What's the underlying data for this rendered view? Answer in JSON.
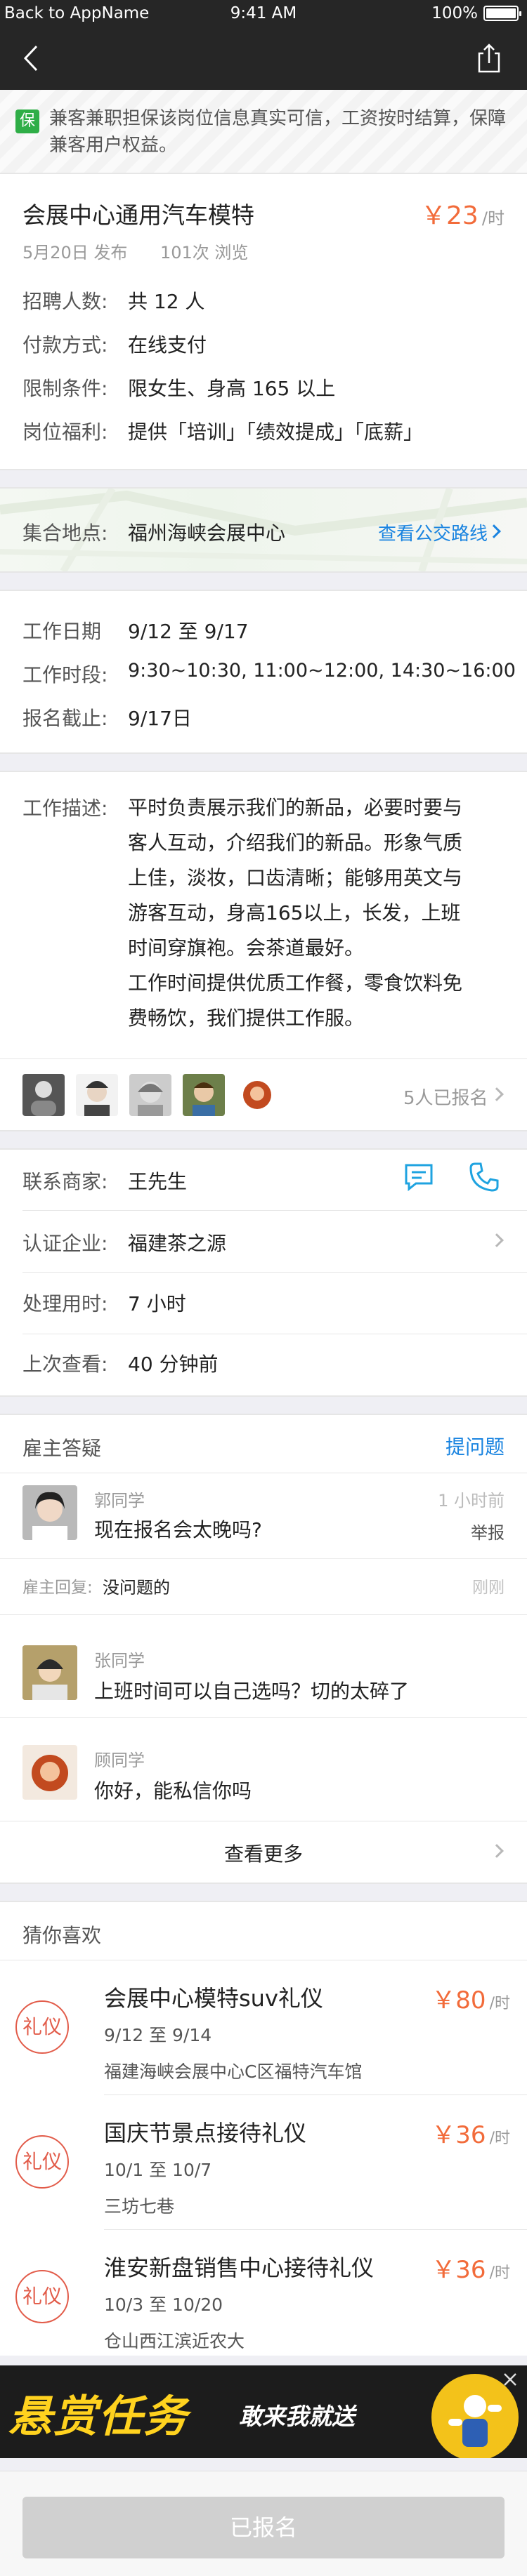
{
  "status": {
    "back": "Back to AppName",
    "time": "9:41 AM",
    "battery": "100%"
  },
  "guarantee": {
    "badge": "保",
    "text": "兼客兼职担保该岗位信息真实可信，工资按时结算，保障兼客用户权益。"
  },
  "job": {
    "title": "会展中心通用汽车模特",
    "salary": "￥23",
    "salary_unit": "/时",
    "date": "5月20日 发布",
    "views": "101次 浏览",
    "rows": [
      {
        "label": "招聘人数:",
        "value": "共 12 人"
      },
      {
        "label": "付款方式:",
        "value": "在线支付"
      },
      {
        "label": "限制条件:",
        "value": "限女生、身高 165 以上"
      },
      {
        "label": "岗位福利:",
        "value": "提供「培训」「绩效提成」「底薪」"
      }
    ]
  },
  "location": {
    "label": "集合地点:",
    "value": "福州海峡会展中心",
    "link": "查看公交路线"
  },
  "schedule": {
    "rows": [
      {
        "label": "工作日期",
        "value": "9/12 至 9/17"
      },
      {
        "label": "工作时段:",
        "value": "9:30~10:30, 11:00~12:00, 14:30~16:00"
      },
      {
        "label": "报名截止:",
        "value": "9/17日"
      }
    ]
  },
  "description": {
    "label": "工作描述:",
    "lines": [
      "平时负责展示我们的新品，必要时要与",
      "客人互动，介绍我们的新品。形象气质",
      "上佳，淡妆，口齿清晰；能够用英文与",
      "游客互动，身高165以上，长发，上班",
      "时间穿旗袍。会茶道最好。",
      "工作时间提供优质工作餐，零食饮料免",
      "费畅饮，我们提供工作服。"
    ],
    "applied": "5人已报名"
  },
  "contact": {
    "merchant_label": "联系商家:",
    "merchant": "王先生",
    "company_label": "认证企业:",
    "company": "福建茶之源",
    "process_label": "处理用时:",
    "process": "7 小时",
    "last_label": "上次查看:",
    "last": "40 分钟前"
  },
  "qa": {
    "title": "雇主答疑",
    "ask": "提问题",
    "items": [
      {
        "user": "郭同学",
        "question": "现在报名会太晚吗?",
        "time": "1 小时前",
        "report": "举报",
        "reply_label": "雇主回复:",
        "reply": "没问题的",
        "reply_time": "刚刚"
      },
      {
        "user": "张同学",
        "question": "上班时间可以自己选吗？切的太碎了"
      },
      {
        "user": "顾同学",
        "question": "你好，能私信你吗"
      }
    ],
    "more": "查看更多"
  },
  "recommend": {
    "title": "猜你喜欢",
    "items": [
      {
        "badge": "礼仪",
        "title": "会展中心模特suv礼仪",
        "salary": "￥80",
        "unit": "/时",
        "date": "9/12 至 9/14",
        "place": "福建海峡会展中心C区福特汽车馆"
      },
      {
        "badge": "礼仪",
        "title": "国庆节景点接待礼仪",
        "salary": "￥36",
        "unit": "/时",
        "date": "10/1 至 10/7",
        "place": "三坊七巷"
      },
      {
        "badge": "礼仪",
        "title": "淮安新盘销售中心接待礼仪",
        "salary": "￥36",
        "unit": "/时",
        "date": "10/3 至 10/20",
        "place": "仓山西江滨近农大"
      }
    ]
  },
  "ad": {
    "big": "悬赏任务",
    "small": "敢来我就送"
  },
  "bottom": {
    "button": "已报名"
  }
}
